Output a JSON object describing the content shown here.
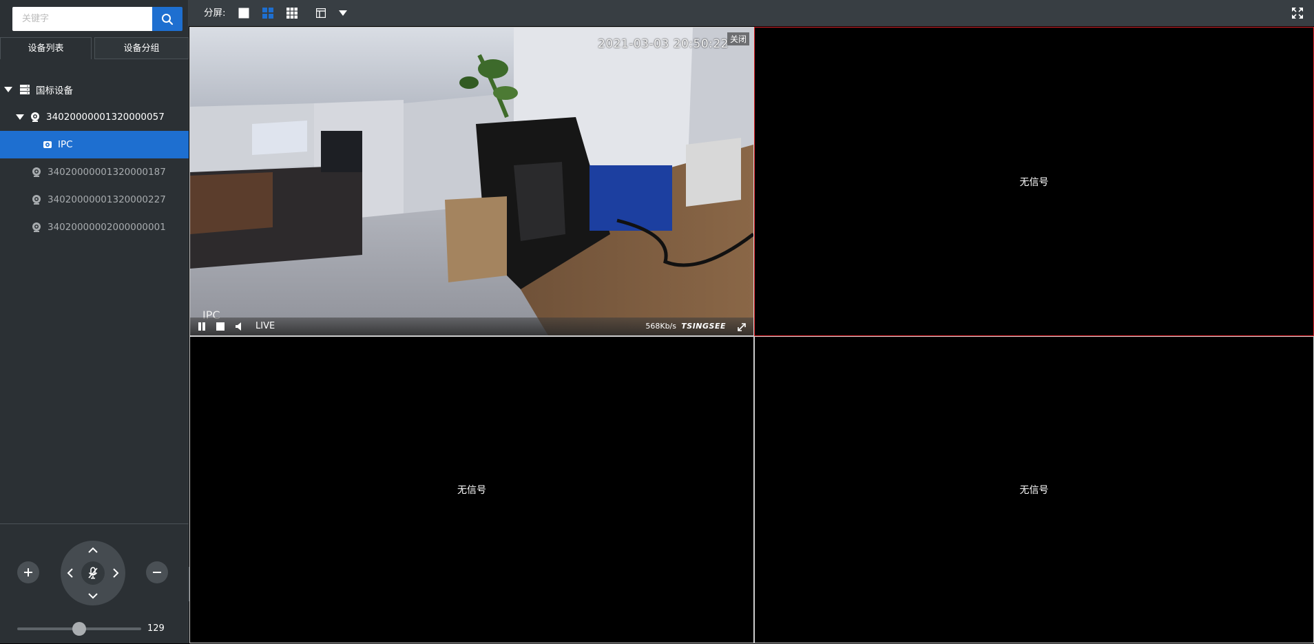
{
  "search": {
    "placeholder": "关键字"
  },
  "tabs": [
    {
      "label": "设备列表"
    },
    {
      "label": "设备分组"
    }
  ],
  "tree": {
    "root": {
      "label": "国标设备",
      "icon": "server-icon"
    },
    "devices": [
      {
        "label": "34020000001320000057",
        "status": "online",
        "icon": "camera-icon",
        "expanded": true,
        "channels": [
          {
            "label": "IPC",
            "selected": true,
            "icon": "channel-camera-icon"
          }
        ]
      },
      {
        "label": "34020000001320000187",
        "status": "offline",
        "icon": "camera-icon"
      },
      {
        "label": "34020000001320000227",
        "status": "offline",
        "icon": "camera-icon"
      },
      {
        "label": "34020000002000000001",
        "status": "offline",
        "icon": "camera-icon"
      }
    ]
  },
  "ptz": {
    "zoom_in": "+",
    "zoom_out": "−",
    "speed_value": "129",
    "speed_fraction": 0.5
  },
  "toolbar": {
    "split_label": "分屏:",
    "layouts": [
      "single-split-icon",
      "quad-split-icon",
      "nine-split-icon",
      "custom-layout-icon"
    ],
    "active_layout": "quad-split-icon"
  },
  "panes": [
    {
      "timestamp": "2021-03-03 20:50:22",
      "close_label": "关闭",
      "channel_name": "IPC",
      "live_label": "LIVE",
      "bitrate": "568Kb/s",
      "brand": "TSINGSEE"
    },
    {
      "no_signal": "无信号"
    },
    {
      "no_signal": "无信号"
    },
    {
      "no_signal": "无信号"
    }
  ],
  "colors": {
    "accent": "#1e6fd0",
    "active_pane_border": "#e0222a",
    "sidebar_bg": "#2b3034"
  }
}
